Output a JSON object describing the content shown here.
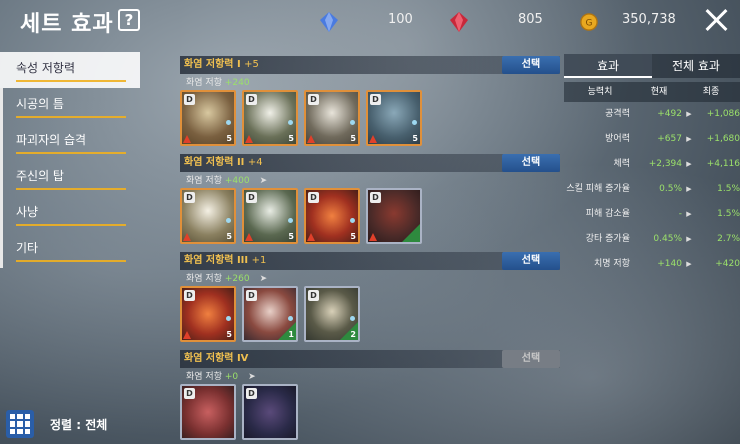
{
  "header": {
    "title": "세트 효과",
    "help": "?",
    "currencies": [
      {
        "icon": "blue-gem-icon",
        "value": "100"
      },
      {
        "icon": "red-gem-icon",
        "value": "805"
      },
      {
        "icon": "gold-coin-icon",
        "value": "350,738"
      }
    ]
  },
  "sidebar": {
    "items": [
      {
        "label": "속성 저항력"
      },
      {
        "label": "시공의 틈"
      },
      {
        "label": "파괴자의 습격"
      },
      {
        "label": "주신의 탑"
      },
      {
        "label": "사냥"
      },
      {
        "label": "기타"
      }
    ]
  },
  "sets": [
    {
      "title": "화염 저항력 I",
      "count": "+5",
      "button": "선택",
      "stat": "화염 저항",
      "bonus": "+240",
      "arrow": "",
      "cards": [
        {
          "lv": "5"
        },
        {
          "lv": "5"
        },
        {
          "lv": "5"
        },
        {
          "lv": "5"
        }
      ]
    },
    {
      "title": "화염 저항력 II",
      "count": "+4",
      "button": "선택",
      "stat": "화염 저항",
      "bonus": "+400",
      "arrow": "➤",
      "cards": [
        {
          "lv": "5"
        },
        {
          "lv": "5"
        },
        {
          "lv": "5"
        },
        {
          "lv": ""
        }
      ]
    },
    {
      "title": "화염 저항력 III",
      "count": "+1",
      "button": "선택",
      "stat": "화염 저항",
      "bonus": "+260",
      "arrow": "➤",
      "cards": [
        {
          "lv": "5"
        },
        {
          "lv": "1"
        },
        {
          "lv": "2"
        }
      ]
    },
    {
      "title": "화염 저항력 IV",
      "count": "",
      "button": "선택",
      "stat": "화염 저항",
      "bonus": "+0",
      "arrow": "➤",
      "cards": [
        {
          "lv": ""
        },
        {
          "lv": ""
        }
      ]
    }
  ],
  "stats": {
    "tabs": [
      "효과",
      "전체 효과"
    ],
    "columns": [
      "능력치",
      "현재",
      "최종"
    ],
    "rows": [
      {
        "name": "공격력",
        "current": "+492",
        "final": "+1,086"
      },
      {
        "name": "방어력",
        "current": "+657",
        "final": "+1,680"
      },
      {
        "name": "체력",
        "current": "+2,394",
        "final": "+4,116"
      },
      {
        "name": "스킬 피해 증가율",
        "current": "0.5%",
        "final": "1.5%"
      },
      {
        "name": "피해 감소율",
        "current": "-",
        "final": "1.5%"
      },
      {
        "name": "강타 증가율",
        "current": "0.45%",
        "final": "2.7%"
      },
      {
        "name": "치명 저항",
        "current": "+140",
        "final": "+420"
      }
    ]
  },
  "footer": {
    "sort_label": "정렬 : 전체"
  }
}
